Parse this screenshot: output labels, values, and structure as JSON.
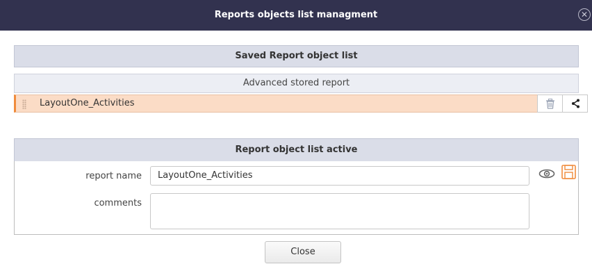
{
  "dialog": {
    "title": "Reports objects list managment",
    "close_icon": "close-circle-icon"
  },
  "saved_list": {
    "header": "Saved Report object list",
    "group_label": "Advanced stored report",
    "items": [
      {
        "label": "LayoutOne_Activities",
        "selected": true,
        "actions": [
          "trash-icon",
          "share-icon"
        ]
      }
    ]
  },
  "active": {
    "header": "Report object list active",
    "report_name_label": "report name",
    "report_name_value": "LayoutOne_Activities",
    "comments_label": "comments",
    "comments_value": "",
    "view_icon": "eye-icon",
    "save_icon": "save-icon"
  },
  "footer": {
    "close_label": "Close"
  },
  "colors": {
    "titlebar": "#32324f",
    "section_header": "#dadde8",
    "selected_row": "#fbdcc6",
    "selected_accent": "#f08c3c"
  }
}
